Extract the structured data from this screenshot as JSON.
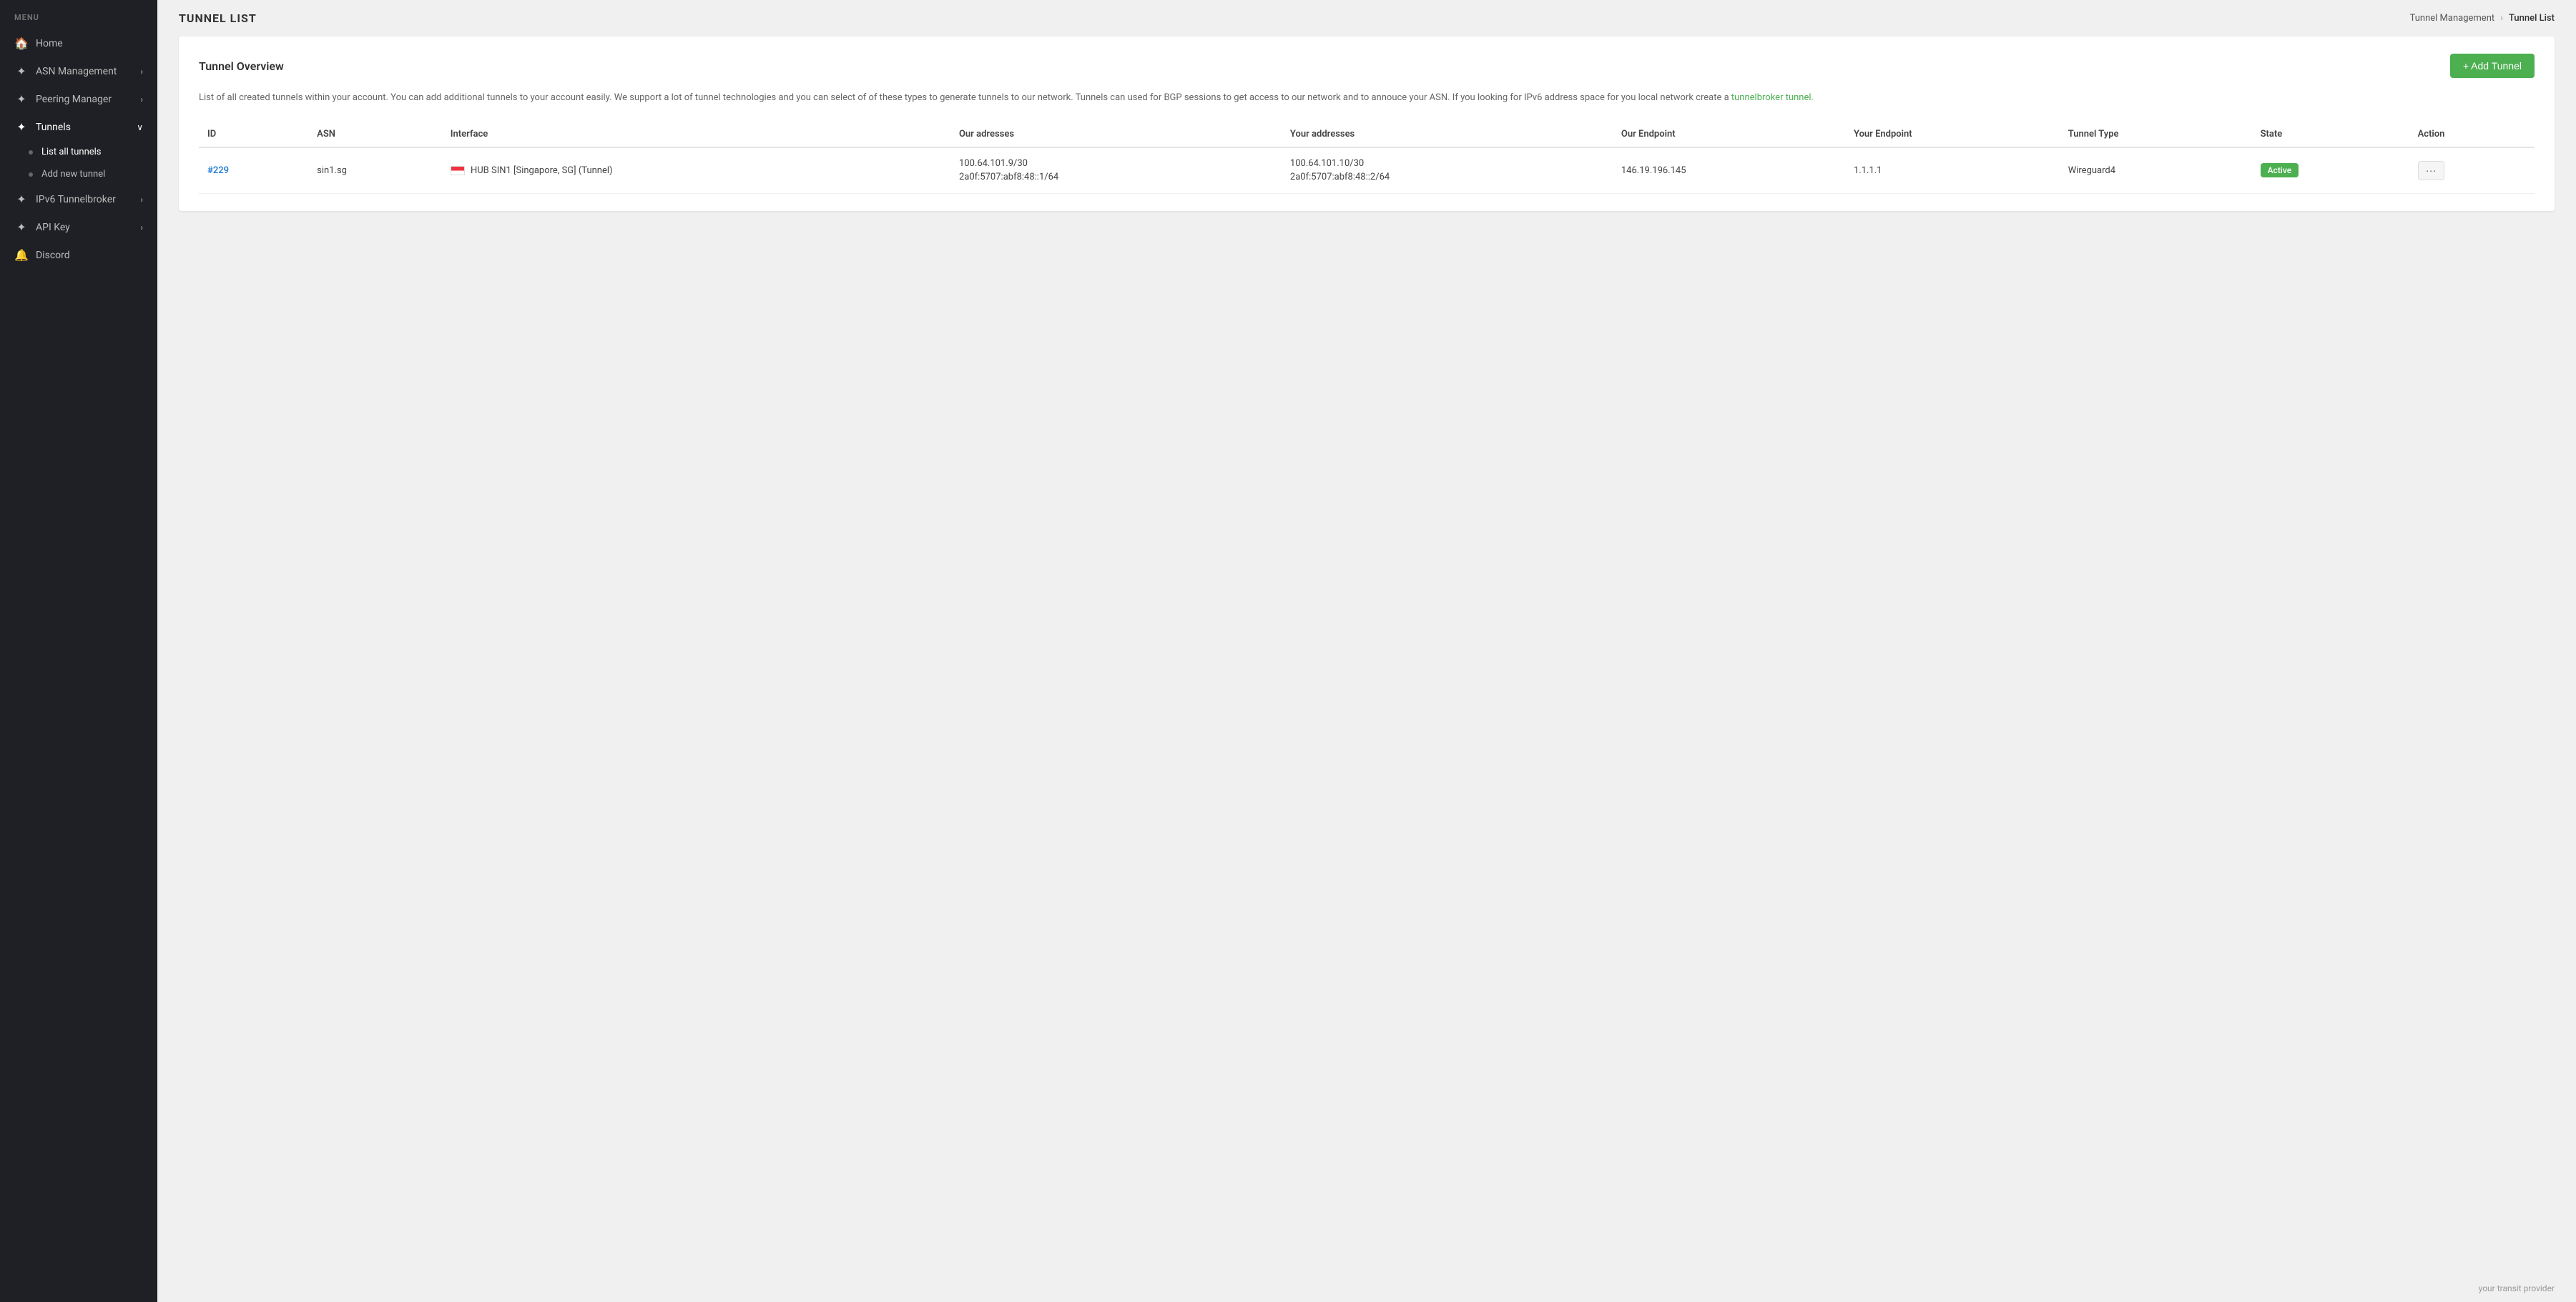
{
  "sidebar": {
    "menu_label": "MENU",
    "items": [
      {
        "id": "home",
        "label": "Home",
        "icon": "🏠",
        "has_chevron": false
      },
      {
        "id": "asn-management",
        "label": "ASN Management",
        "icon": "✦",
        "has_chevron": true
      },
      {
        "id": "peering-manager",
        "label": "Peering Manager",
        "icon": "✦",
        "has_chevron": true
      },
      {
        "id": "tunnels",
        "label": "Tunnels",
        "icon": "✦",
        "has_chevron": true,
        "active": true
      },
      {
        "id": "ipv6-tunnelbroker",
        "label": "IPv6 Tunnelbroker",
        "icon": "✦",
        "has_chevron": true
      },
      {
        "id": "api-key",
        "label": "API Key",
        "icon": "✦",
        "has_chevron": true
      },
      {
        "id": "discord",
        "label": "Discord",
        "icon": "🔔",
        "has_chevron": false
      }
    ],
    "sub_items": [
      {
        "id": "list-all-tunnels",
        "label": "List all tunnels",
        "active": true
      },
      {
        "id": "add-new-tunnel",
        "label": "Add new tunnel"
      }
    ]
  },
  "header": {
    "page_title": "TUNNEL LIST",
    "breadcrumb": [
      {
        "label": "Tunnel Management",
        "link": true
      },
      {
        "label": "Tunnel List",
        "link": false
      }
    ]
  },
  "card": {
    "title": "Tunnel Overview",
    "add_button_label": "+ Add Tunnel",
    "description": "List of all created tunnels within your account. You can add additional tunnels to your account easily. We support a lot of tunnel technologies and you can select of of these types to generate tunnels to our network. Tunnels can used for BGP sessions to get access to our network and to annouce your ASN. If you looking for IPv6 address space for you local network create a",
    "description_link_text": "tunnelbroker tunnel.",
    "description_link": "#",
    "table": {
      "columns": [
        "ID",
        "ASN",
        "Interface",
        "Our adresses",
        "Your addresses",
        "Our Endpoint",
        "Your Endpoint",
        "Tunnel Type",
        "State",
        "Action"
      ],
      "rows": [
        {
          "id": "#229",
          "id_link": "#",
          "asn": "sin1.sg",
          "flag": "SG",
          "interface": "HUB SIN1 [Singapore, SG] (Tunnel)",
          "our_addresses_line1": "100.64.101.9/30",
          "our_addresses_line2": "2a0f:5707:abf8:48::1/64",
          "your_addresses_line1": "100.64.101.10/30",
          "your_addresses_line2": "2a0f:5707:abf8:48::2/64",
          "our_endpoint": "146.19.196.145",
          "your_endpoint": "1.1.1.1",
          "tunnel_type": "Wireguard4",
          "state": "Active",
          "action": "···"
        }
      ]
    }
  },
  "footer": {
    "text": "your transit provider"
  },
  "colors": {
    "active_badge": "#4caf50",
    "add_button": "#4caf50",
    "sidebar_bg": "#1e2025",
    "link_blue": "#1976d2"
  }
}
